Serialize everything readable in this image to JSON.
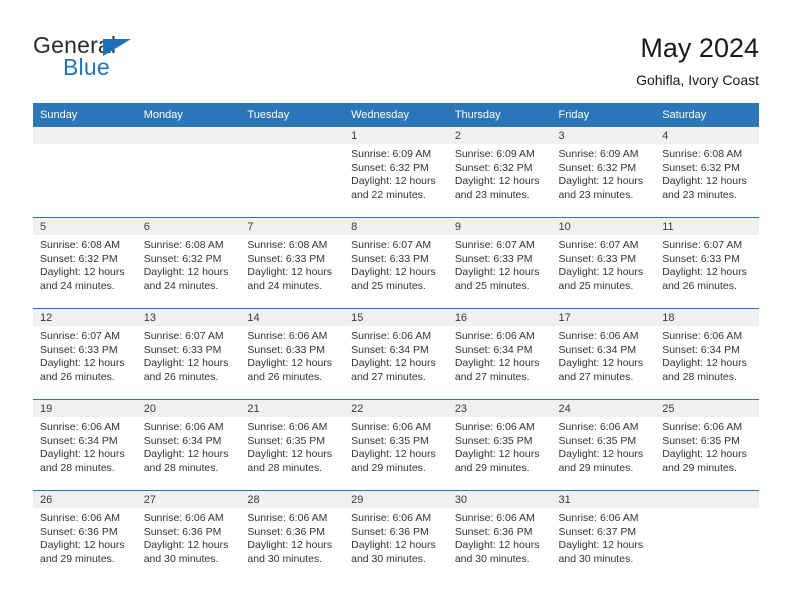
{
  "brand": {
    "name_top": "General",
    "name_bottom": "Blue",
    "triangle_color": "#1e6fb8",
    "blue_color": "#1f76bc"
  },
  "header": {
    "title": "May 2024",
    "subtitle": "Gohifla, Ivory Coast"
  },
  "theme": {
    "header_bar_color": "#2b76b9",
    "daynum_band_color": "#f0f0f0",
    "text_color": "#333333"
  },
  "weekdays": [
    "Sunday",
    "Monday",
    "Tuesday",
    "Wednesday",
    "Thursday",
    "Friday",
    "Saturday"
  ],
  "labels": {
    "sunrise_prefix": "Sunrise:",
    "sunset_prefix": "Sunset:",
    "daylight_prefix": "Daylight:"
  },
  "weeks": [
    [
      {
        "day": "",
        "empty": true
      },
      {
        "day": "",
        "empty": true
      },
      {
        "day": "",
        "empty": true
      },
      {
        "day": "1",
        "sunrise": "Sunrise: 6:09 AM",
        "sunset": "Sunset: 6:32 PM",
        "daylight_line1": "Daylight: 12 hours",
        "daylight_line2": "and 22 minutes."
      },
      {
        "day": "2",
        "sunrise": "Sunrise: 6:09 AM",
        "sunset": "Sunset: 6:32 PM",
        "daylight_line1": "Daylight: 12 hours",
        "daylight_line2": "and 23 minutes."
      },
      {
        "day": "3",
        "sunrise": "Sunrise: 6:09 AM",
        "sunset": "Sunset: 6:32 PM",
        "daylight_line1": "Daylight: 12 hours",
        "daylight_line2": "and 23 minutes."
      },
      {
        "day": "4",
        "sunrise": "Sunrise: 6:08 AM",
        "sunset": "Sunset: 6:32 PM",
        "daylight_line1": "Daylight: 12 hours",
        "daylight_line2": "and 23 minutes."
      }
    ],
    [
      {
        "day": "5",
        "sunrise": "Sunrise: 6:08 AM",
        "sunset": "Sunset: 6:32 PM",
        "daylight_line1": "Daylight: 12 hours",
        "daylight_line2": "and 24 minutes."
      },
      {
        "day": "6",
        "sunrise": "Sunrise: 6:08 AM",
        "sunset": "Sunset: 6:32 PM",
        "daylight_line1": "Daylight: 12 hours",
        "daylight_line2": "and 24 minutes."
      },
      {
        "day": "7",
        "sunrise": "Sunrise: 6:08 AM",
        "sunset": "Sunset: 6:33 PM",
        "daylight_line1": "Daylight: 12 hours",
        "daylight_line2": "and 24 minutes."
      },
      {
        "day": "8",
        "sunrise": "Sunrise: 6:07 AM",
        "sunset": "Sunset: 6:33 PM",
        "daylight_line1": "Daylight: 12 hours",
        "daylight_line2": "and 25 minutes."
      },
      {
        "day": "9",
        "sunrise": "Sunrise: 6:07 AM",
        "sunset": "Sunset: 6:33 PM",
        "daylight_line1": "Daylight: 12 hours",
        "daylight_line2": "and 25 minutes."
      },
      {
        "day": "10",
        "sunrise": "Sunrise: 6:07 AM",
        "sunset": "Sunset: 6:33 PM",
        "daylight_line1": "Daylight: 12 hours",
        "daylight_line2": "and 25 minutes."
      },
      {
        "day": "11",
        "sunrise": "Sunrise: 6:07 AM",
        "sunset": "Sunset: 6:33 PM",
        "daylight_line1": "Daylight: 12 hours",
        "daylight_line2": "and 26 minutes."
      }
    ],
    [
      {
        "day": "12",
        "sunrise": "Sunrise: 6:07 AM",
        "sunset": "Sunset: 6:33 PM",
        "daylight_line1": "Daylight: 12 hours",
        "daylight_line2": "and 26 minutes."
      },
      {
        "day": "13",
        "sunrise": "Sunrise: 6:07 AM",
        "sunset": "Sunset: 6:33 PM",
        "daylight_line1": "Daylight: 12 hours",
        "daylight_line2": "and 26 minutes."
      },
      {
        "day": "14",
        "sunrise": "Sunrise: 6:06 AM",
        "sunset": "Sunset: 6:33 PM",
        "daylight_line1": "Daylight: 12 hours",
        "daylight_line2": "and 26 minutes."
      },
      {
        "day": "15",
        "sunrise": "Sunrise: 6:06 AM",
        "sunset": "Sunset: 6:34 PM",
        "daylight_line1": "Daylight: 12 hours",
        "daylight_line2": "and 27 minutes."
      },
      {
        "day": "16",
        "sunrise": "Sunrise: 6:06 AM",
        "sunset": "Sunset: 6:34 PM",
        "daylight_line1": "Daylight: 12 hours",
        "daylight_line2": "and 27 minutes."
      },
      {
        "day": "17",
        "sunrise": "Sunrise: 6:06 AM",
        "sunset": "Sunset: 6:34 PM",
        "daylight_line1": "Daylight: 12 hours",
        "daylight_line2": "and 27 minutes."
      },
      {
        "day": "18",
        "sunrise": "Sunrise: 6:06 AM",
        "sunset": "Sunset: 6:34 PM",
        "daylight_line1": "Daylight: 12 hours",
        "daylight_line2": "and 28 minutes."
      }
    ],
    [
      {
        "day": "19",
        "sunrise": "Sunrise: 6:06 AM",
        "sunset": "Sunset: 6:34 PM",
        "daylight_line1": "Daylight: 12 hours",
        "daylight_line2": "and 28 minutes."
      },
      {
        "day": "20",
        "sunrise": "Sunrise: 6:06 AM",
        "sunset": "Sunset: 6:34 PM",
        "daylight_line1": "Daylight: 12 hours",
        "daylight_line2": "and 28 minutes."
      },
      {
        "day": "21",
        "sunrise": "Sunrise: 6:06 AM",
        "sunset": "Sunset: 6:35 PM",
        "daylight_line1": "Daylight: 12 hours",
        "daylight_line2": "and 28 minutes."
      },
      {
        "day": "22",
        "sunrise": "Sunrise: 6:06 AM",
        "sunset": "Sunset: 6:35 PM",
        "daylight_line1": "Daylight: 12 hours",
        "daylight_line2": "and 29 minutes."
      },
      {
        "day": "23",
        "sunrise": "Sunrise: 6:06 AM",
        "sunset": "Sunset: 6:35 PM",
        "daylight_line1": "Daylight: 12 hours",
        "daylight_line2": "and 29 minutes."
      },
      {
        "day": "24",
        "sunrise": "Sunrise: 6:06 AM",
        "sunset": "Sunset: 6:35 PM",
        "daylight_line1": "Daylight: 12 hours",
        "daylight_line2": "and 29 minutes."
      },
      {
        "day": "25",
        "sunrise": "Sunrise: 6:06 AM",
        "sunset": "Sunset: 6:35 PM",
        "daylight_line1": "Daylight: 12 hours",
        "daylight_line2": "and 29 minutes."
      }
    ],
    [
      {
        "day": "26",
        "sunrise": "Sunrise: 6:06 AM",
        "sunset": "Sunset: 6:36 PM",
        "daylight_line1": "Daylight: 12 hours",
        "daylight_line2": "and 29 minutes."
      },
      {
        "day": "27",
        "sunrise": "Sunrise: 6:06 AM",
        "sunset": "Sunset: 6:36 PM",
        "daylight_line1": "Daylight: 12 hours",
        "daylight_line2": "and 30 minutes."
      },
      {
        "day": "28",
        "sunrise": "Sunrise: 6:06 AM",
        "sunset": "Sunset: 6:36 PM",
        "daylight_line1": "Daylight: 12 hours",
        "daylight_line2": "and 30 minutes."
      },
      {
        "day": "29",
        "sunrise": "Sunrise: 6:06 AM",
        "sunset": "Sunset: 6:36 PM",
        "daylight_line1": "Daylight: 12 hours",
        "daylight_line2": "and 30 minutes."
      },
      {
        "day": "30",
        "sunrise": "Sunrise: 6:06 AM",
        "sunset": "Sunset: 6:36 PM",
        "daylight_line1": "Daylight: 12 hours",
        "daylight_line2": "and 30 minutes."
      },
      {
        "day": "31",
        "sunrise": "Sunrise: 6:06 AM",
        "sunset": "Sunset: 6:37 PM",
        "daylight_line1": "Daylight: 12 hours",
        "daylight_line2": "and 30 minutes."
      },
      {
        "day": "",
        "empty": true
      }
    ]
  ]
}
